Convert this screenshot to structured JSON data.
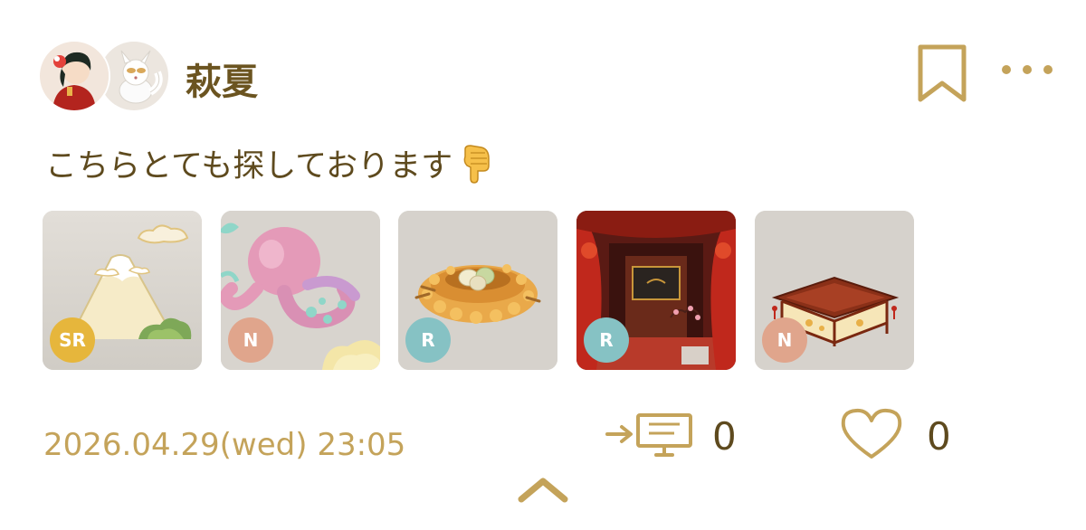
{
  "user": {
    "name": "萩夏"
  },
  "post": {
    "text": "こちらとても探しております",
    "timestamp": "2026.04.29(wed) 23:05"
  },
  "items": [
    {
      "name": "mountain",
      "rarity": "SR",
      "rarity_color": "#e6b63c"
    },
    {
      "name": "octopus",
      "rarity": "N",
      "rarity_color": "#e0a58c"
    },
    {
      "name": "nest",
      "rarity": "R",
      "rarity_color": "#86c2c4"
    },
    {
      "name": "red-hall",
      "rarity": "R",
      "rarity_color": "#86c2c4"
    },
    {
      "name": "lantern-table",
      "rarity": "N",
      "rarity_color": "#e0a58c"
    }
  ],
  "stats": {
    "shares": "0",
    "likes": "0"
  },
  "colors": {
    "accent_gold": "#c4a35a",
    "text_brown": "#5e4a1e"
  },
  "icons": {
    "bookmark": "bookmark-icon",
    "more": "more-options-icon",
    "share": "share-board-icon",
    "like": "heart-icon",
    "collapse": "chevron-up-icon"
  }
}
